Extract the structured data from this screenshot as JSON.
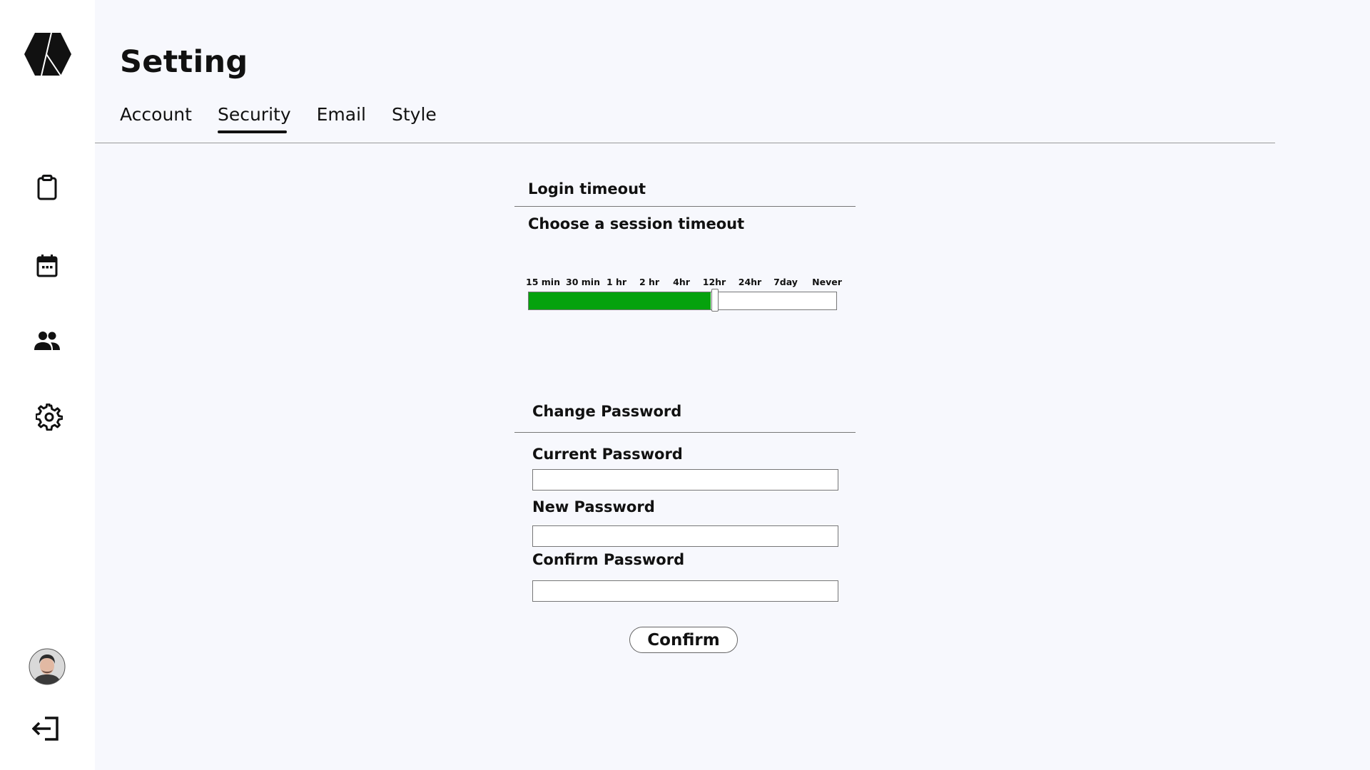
{
  "app": {
    "logo_icon": "hexagon-logo-icon"
  },
  "sidebar": {
    "items": [
      {
        "icon": "clipboard-icon"
      },
      {
        "icon": "calendar-icon"
      },
      {
        "icon": "people-icon"
      },
      {
        "icon": "gear-icon"
      }
    ],
    "avatar_icon": "user-avatar",
    "logout_icon": "logout-icon"
  },
  "header": {
    "title": "Setting"
  },
  "tabs": [
    {
      "label": "Account",
      "active": false
    },
    {
      "label": "Security",
      "active": true
    },
    {
      "label": "Email",
      "active": false
    },
    {
      "label": "Style",
      "active": false
    }
  ],
  "login_timeout": {
    "title": "Login timeout",
    "subtitle": "Choose a session timeout",
    "options": [
      "15 min",
      "30 min",
      "1 hr",
      "2 hr",
      "4hr",
      "12hr",
      "24hr",
      "7day",
      "Never"
    ],
    "selected": "12hr",
    "fill_fraction": 0.59,
    "fill_color": "#05a20d"
  },
  "change_password": {
    "title": "Change Password",
    "current_label": "Current Password",
    "current_value": "",
    "new_label": "New Password",
    "new_value": "",
    "confirm_label": "Confirm Password",
    "confirm_value": "",
    "confirm_button": "Confirm"
  }
}
